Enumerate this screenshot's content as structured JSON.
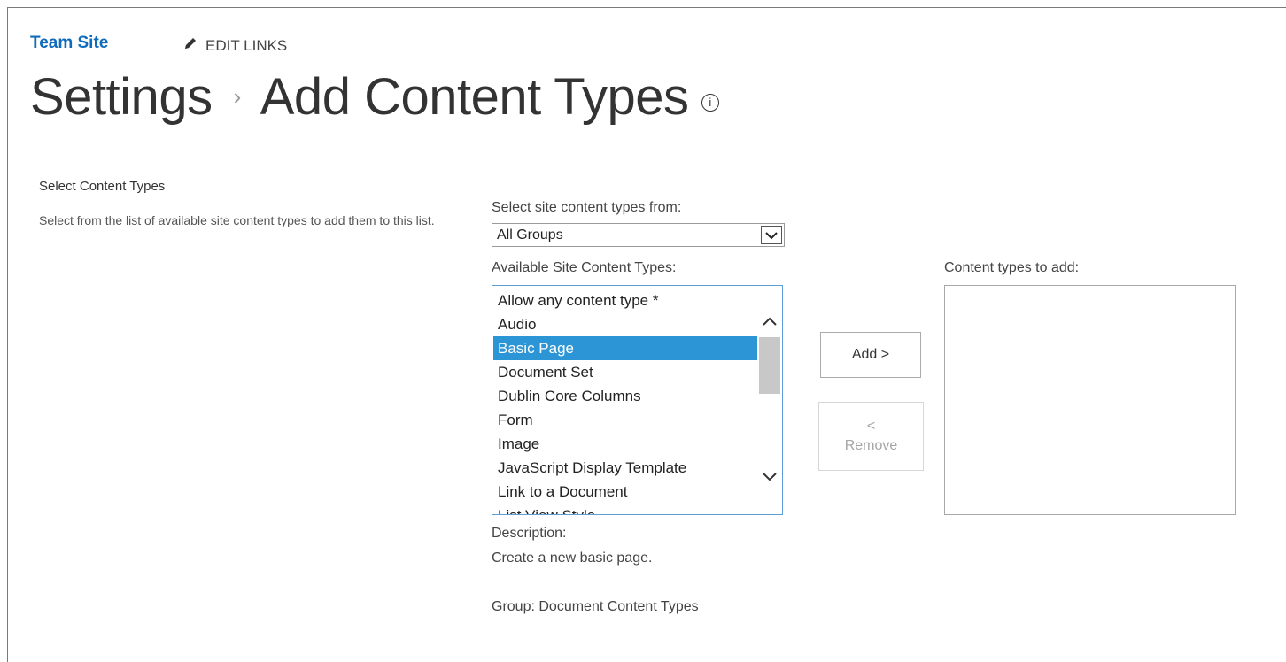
{
  "header": {
    "site_link": "Team Site",
    "edit_links": "EDIT LINKS",
    "breadcrumb_parent": "Settings",
    "breadcrumb_separator": "›",
    "page_title": "Add Content Types",
    "info_icon_glyph": "i"
  },
  "section": {
    "title": "Select Content Types",
    "description": "Select from the list of available site content types to add them to this list."
  },
  "group_select": {
    "label": "Select site content types from:",
    "selected_value": "All Groups"
  },
  "available": {
    "label": "Available Site Content Types:",
    "items": [
      "Allow any content type *",
      "Audio",
      "Basic Page",
      "Document Set",
      "Dublin Core Columns",
      "Form",
      "Image",
      "JavaScript Display Template",
      "Link to a Document",
      "List View Style"
    ],
    "selected_index": 2
  },
  "buttons": {
    "add_label": "Add >",
    "remove_arrow": "<",
    "remove_label": "Remove"
  },
  "to_add": {
    "label": "Content types to add:",
    "items": []
  },
  "details": {
    "description_label": "Description:",
    "description_text": "Create a new basic page.",
    "group_text": "Group: Document Content Types"
  },
  "colors": {
    "link_blue": "#0f6cbd",
    "selection_blue": "#2b95d6",
    "listbox_border": "#5f9ed6"
  }
}
